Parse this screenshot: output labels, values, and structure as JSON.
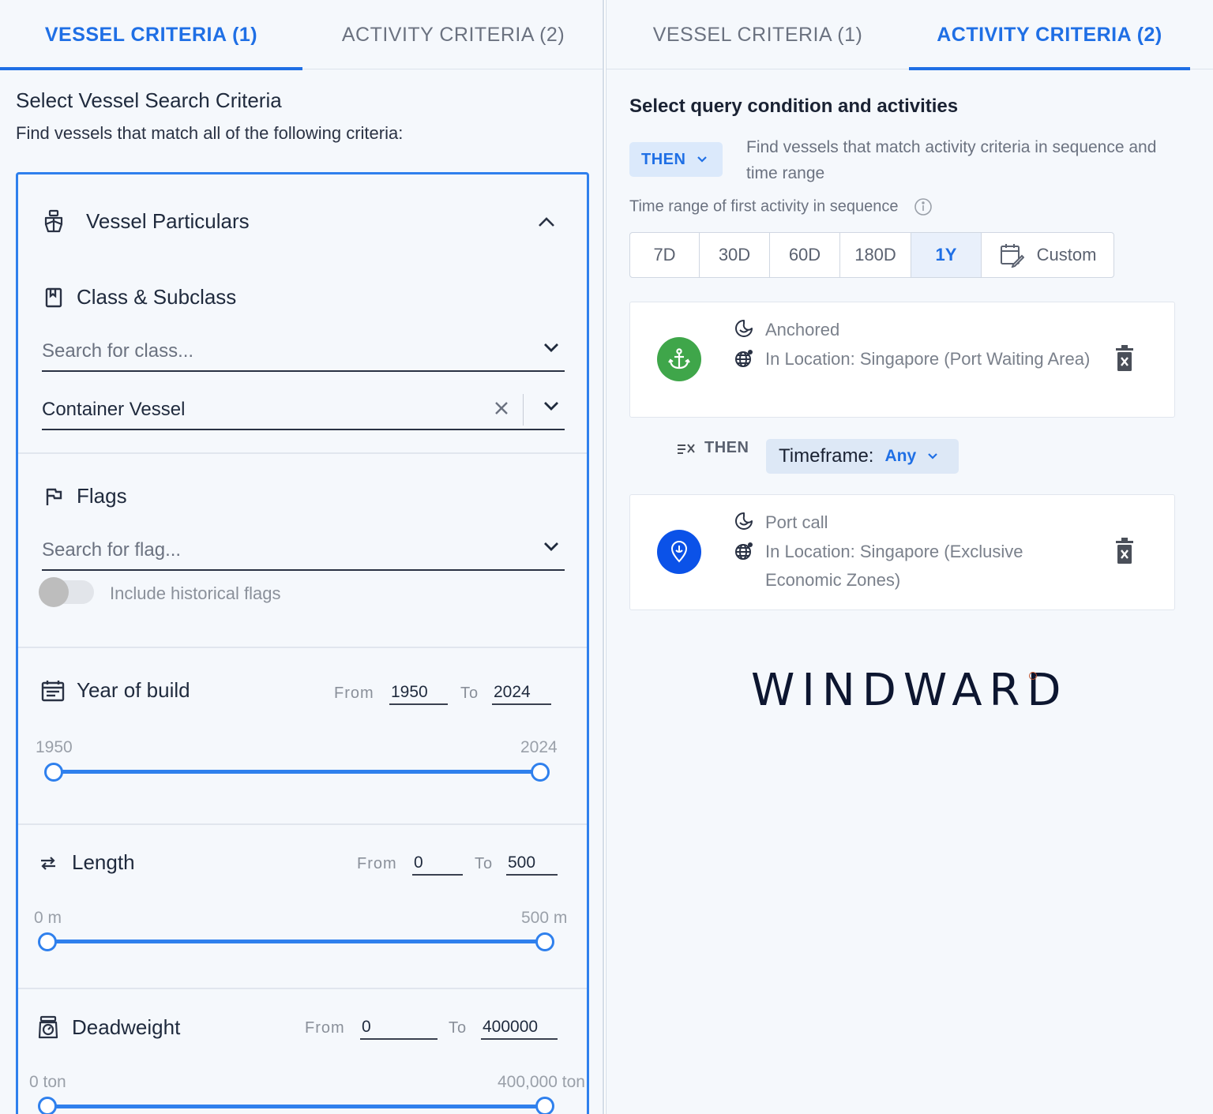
{
  "left": {
    "tabs": [
      {
        "label": "VESSEL CRITERIA (1)",
        "active": true
      },
      {
        "label": "ACTIVITY CRITERIA (2)",
        "active": false
      }
    ],
    "title": "Select Vessel Search Criteria",
    "subtitle": "Find vessels that match all of the following criteria:",
    "vessel_particulars": {
      "label": "Vessel Particulars",
      "icon": "ship-icon",
      "collapse_icon": "chevron-up-icon"
    },
    "class_subclass": {
      "label": "Class & Subclass",
      "icon": "bookmark-icon",
      "search_placeholder": "Search for class...",
      "selected_value": "Container Vessel"
    },
    "flags": {
      "label": "Flags",
      "icon": "flag-icon",
      "search_placeholder": "Search for flag...",
      "historical_toggle_label": "Include historical flags",
      "historical_toggle_on": false
    },
    "year_of_build": {
      "label": "Year of build",
      "icon": "calendar-icon",
      "from_label": "From",
      "to_label": "To",
      "from_value": "1950",
      "to_value": "2024",
      "min_label": "1950",
      "max_label": "2024",
      "min": 1950,
      "max": 2024
    },
    "length": {
      "label": "Length",
      "icon": "arrows-horizontal-icon",
      "from_label": "From",
      "to_label": "To",
      "from_value": "0",
      "to_value": "500",
      "min_label": "0 m",
      "max_label": "500 m",
      "min": 0,
      "max": 500
    },
    "deadweight": {
      "label": "Deadweight",
      "icon": "weight-icon",
      "from_label": "From",
      "to_label": "To",
      "from_value": "0",
      "to_value": "400000",
      "min_label": "0 ton",
      "max_label": "400,000 ton",
      "min": 0,
      "max": 400000
    }
  },
  "right": {
    "tabs": [
      {
        "label": "VESSEL CRITERIA (1)",
        "active": false
      },
      {
        "label": "ACTIVITY CRITERIA (2)",
        "active": true
      }
    ],
    "title": "Select query condition and activities",
    "condition_button": "THEN",
    "condition_description": "Find vessels that match activity criteria in sequence and time range",
    "time_range_label": "Time range of first activity in sequence",
    "time_range_options": [
      "7D",
      "30D",
      "60D",
      "180D",
      "1Y",
      "Custom"
    ],
    "time_range_selected": "1Y",
    "activities": [
      {
        "name": "Anchored",
        "location": "In Location: Singapore (Port Waiting Area)",
        "icon": "anchor-icon",
        "color": "#3fa64a"
      },
      {
        "name": "Port call",
        "location": "In Location: Singapore (Exclusive Economic Zones)",
        "icon": "location-pin-icon",
        "color": "#0b52e8"
      }
    ],
    "sequence_connector": {
      "label": "THEN",
      "timeframe_label": "Timeframe:",
      "timeframe_value": "Any"
    },
    "logo_text": "WINDWARD"
  },
  "colors": {
    "accent": "#1f6fe5",
    "panel_bg": "#f5f8fc",
    "anchored_green": "#3fa64a",
    "portcall_blue": "#0b52e8"
  }
}
